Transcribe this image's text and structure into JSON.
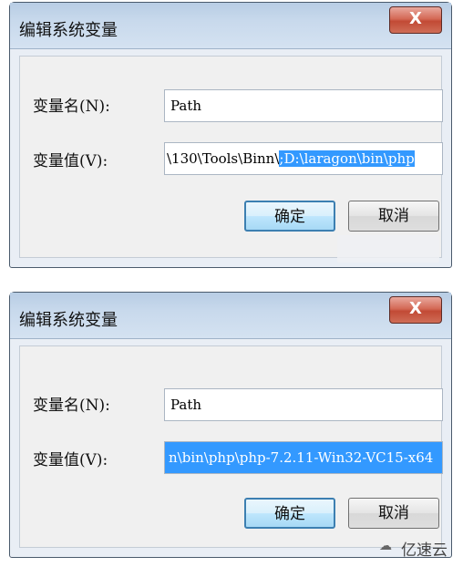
{
  "dialogs": [
    {
      "title": "编辑系统变量",
      "close_label": "X",
      "name_label": "变量名(N):",
      "name_value": "Path",
      "value_label": "变量值(V):",
      "value_unselected": "\\130\\Tools\\Binn\\",
      "value_selected": ";D:\\laragon\\bin\\php",
      "ok_label": "确定",
      "cancel_label": "取消"
    },
    {
      "title": "编辑系统变量",
      "close_label": "X",
      "name_label": "变量名(N):",
      "name_value": "Path",
      "value_label": "变量值(V):",
      "value_selected": "n\\bin\\php\\php-7.2.11-Win32-VC15-x64",
      "ok_label": "确定",
      "cancel_label": "取消"
    }
  ],
  "watermark": {
    "icon": "cloud-logo-icon",
    "text": "亿速云"
  },
  "colors": {
    "selection": "#3399ff",
    "titlebar": "#c8d9ec",
    "close_button": "#c24a35"
  }
}
